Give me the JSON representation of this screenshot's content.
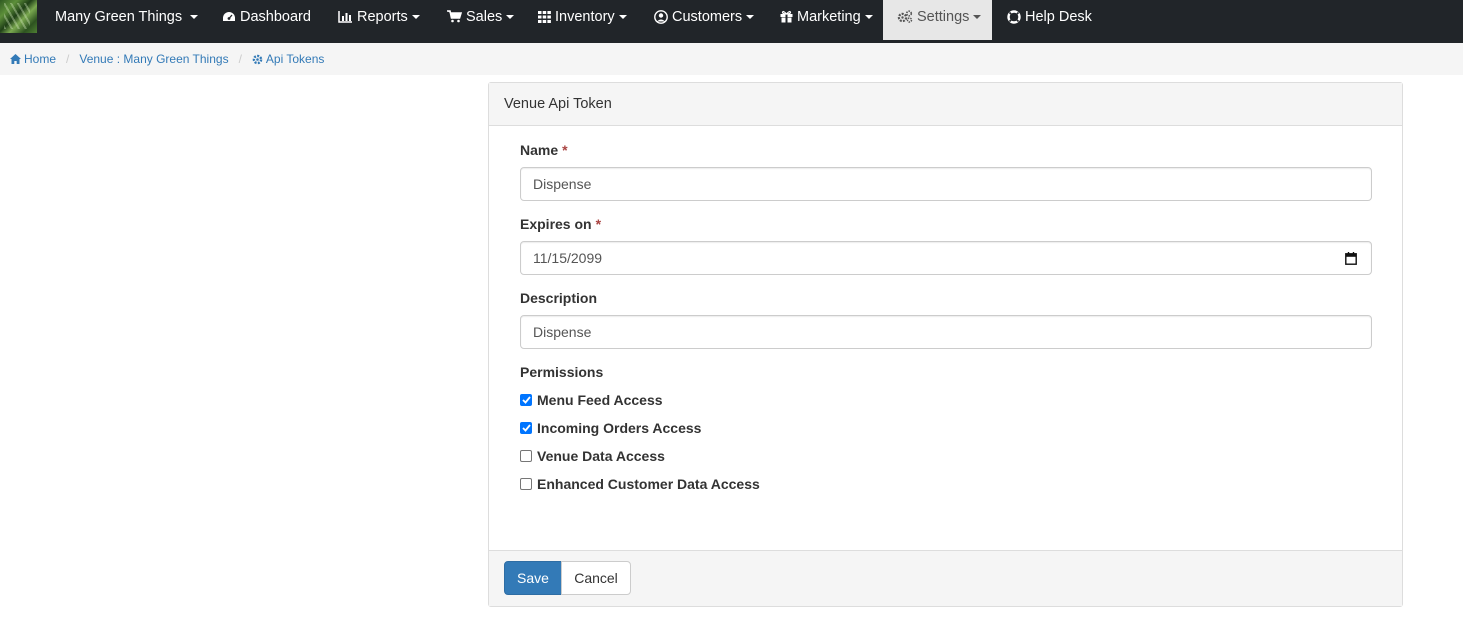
{
  "navbar": {
    "brand": "Many Green Things",
    "items": [
      {
        "label": "Dashboard",
        "icon": "dashboard-icon"
      },
      {
        "label": "Reports",
        "icon": "bar-chart-icon"
      },
      {
        "label": "Sales",
        "icon": "shopping-cart-icon"
      },
      {
        "label": "Inventory",
        "icon": "grid-icon"
      },
      {
        "label": "Customers",
        "icon": "user-circle-icon"
      },
      {
        "label": "Marketing",
        "icon": "gift-icon"
      },
      {
        "label": "Settings",
        "icon": "gears-icon"
      },
      {
        "label": "Help Desk",
        "icon": "life-ring-icon"
      }
    ]
  },
  "breadcrumb": {
    "home": "Home",
    "venue": "Venue : Many Green Things",
    "current": "Api Tokens"
  },
  "panel": {
    "title": "Venue Api Token",
    "name_label": "Name",
    "name_value": "Dispense",
    "expires_label": "Expires on",
    "expires_value": "11/15/2099",
    "description_label": "Description",
    "description_value": "Dispense",
    "required_marker": "*",
    "permissions_label": "Permissions",
    "permissions": [
      {
        "label": "Menu Feed Access",
        "checked": true
      },
      {
        "label": "Incoming Orders Access",
        "checked": true
      },
      {
        "label": "Venue Data Access",
        "checked": false
      },
      {
        "label": "Enhanced Customer Data Access",
        "checked": false
      }
    ],
    "save_label": "Save",
    "cancel_label": "Cancel"
  },
  "colors": {
    "navbar_bg": "#212529",
    "primary": "#337ab7",
    "link": "#337ab7",
    "required": "#a94442",
    "checkbox_checked": "#0075ff"
  }
}
